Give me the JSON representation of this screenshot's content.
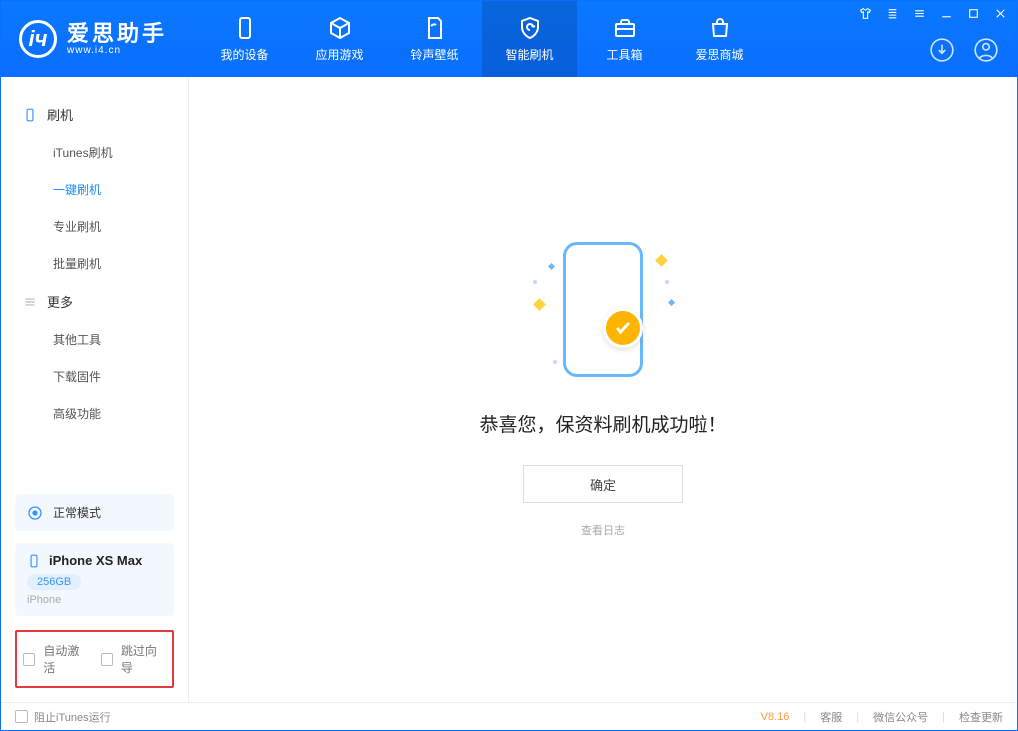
{
  "app": {
    "title": "爱思助手",
    "subtitle": "www.i4.cn"
  },
  "nav": {
    "items": [
      {
        "label": "我的设备"
      },
      {
        "label": "应用游戏"
      },
      {
        "label": "铃声壁纸"
      },
      {
        "label": "智能刷机"
      },
      {
        "label": "工具箱"
      },
      {
        "label": "爱思商城"
      }
    ]
  },
  "sidebar": {
    "section1": {
      "title": "刷机"
    },
    "items1": {
      "a": "iTunes刷机",
      "b": "一键刷机",
      "c": "专业刷机",
      "d": "批量刷机"
    },
    "section2": {
      "title": "更多"
    },
    "items2": {
      "a": "其他工具",
      "b": "下载固件",
      "c": "高级功能"
    },
    "mode": {
      "label": "正常模式"
    },
    "device": {
      "name": "iPhone XS Max",
      "capacity": "256GB",
      "os": "iPhone"
    },
    "options": {
      "autoActivate": "自动激活",
      "skipGuide": "跳过向导"
    }
  },
  "main": {
    "successTitle": "恭喜您，保资料刷机成功啦！",
    "okButton": "确定",
    "viewLog": "查看日志"
  },
  "footer": {
    "blockItunes": "阻止iTunes运行",
    "version": "V8.16",
    "service": "客服",
    "wechat": "微信公众号",
    "checkUpdate": "检查更新"
  }
}
